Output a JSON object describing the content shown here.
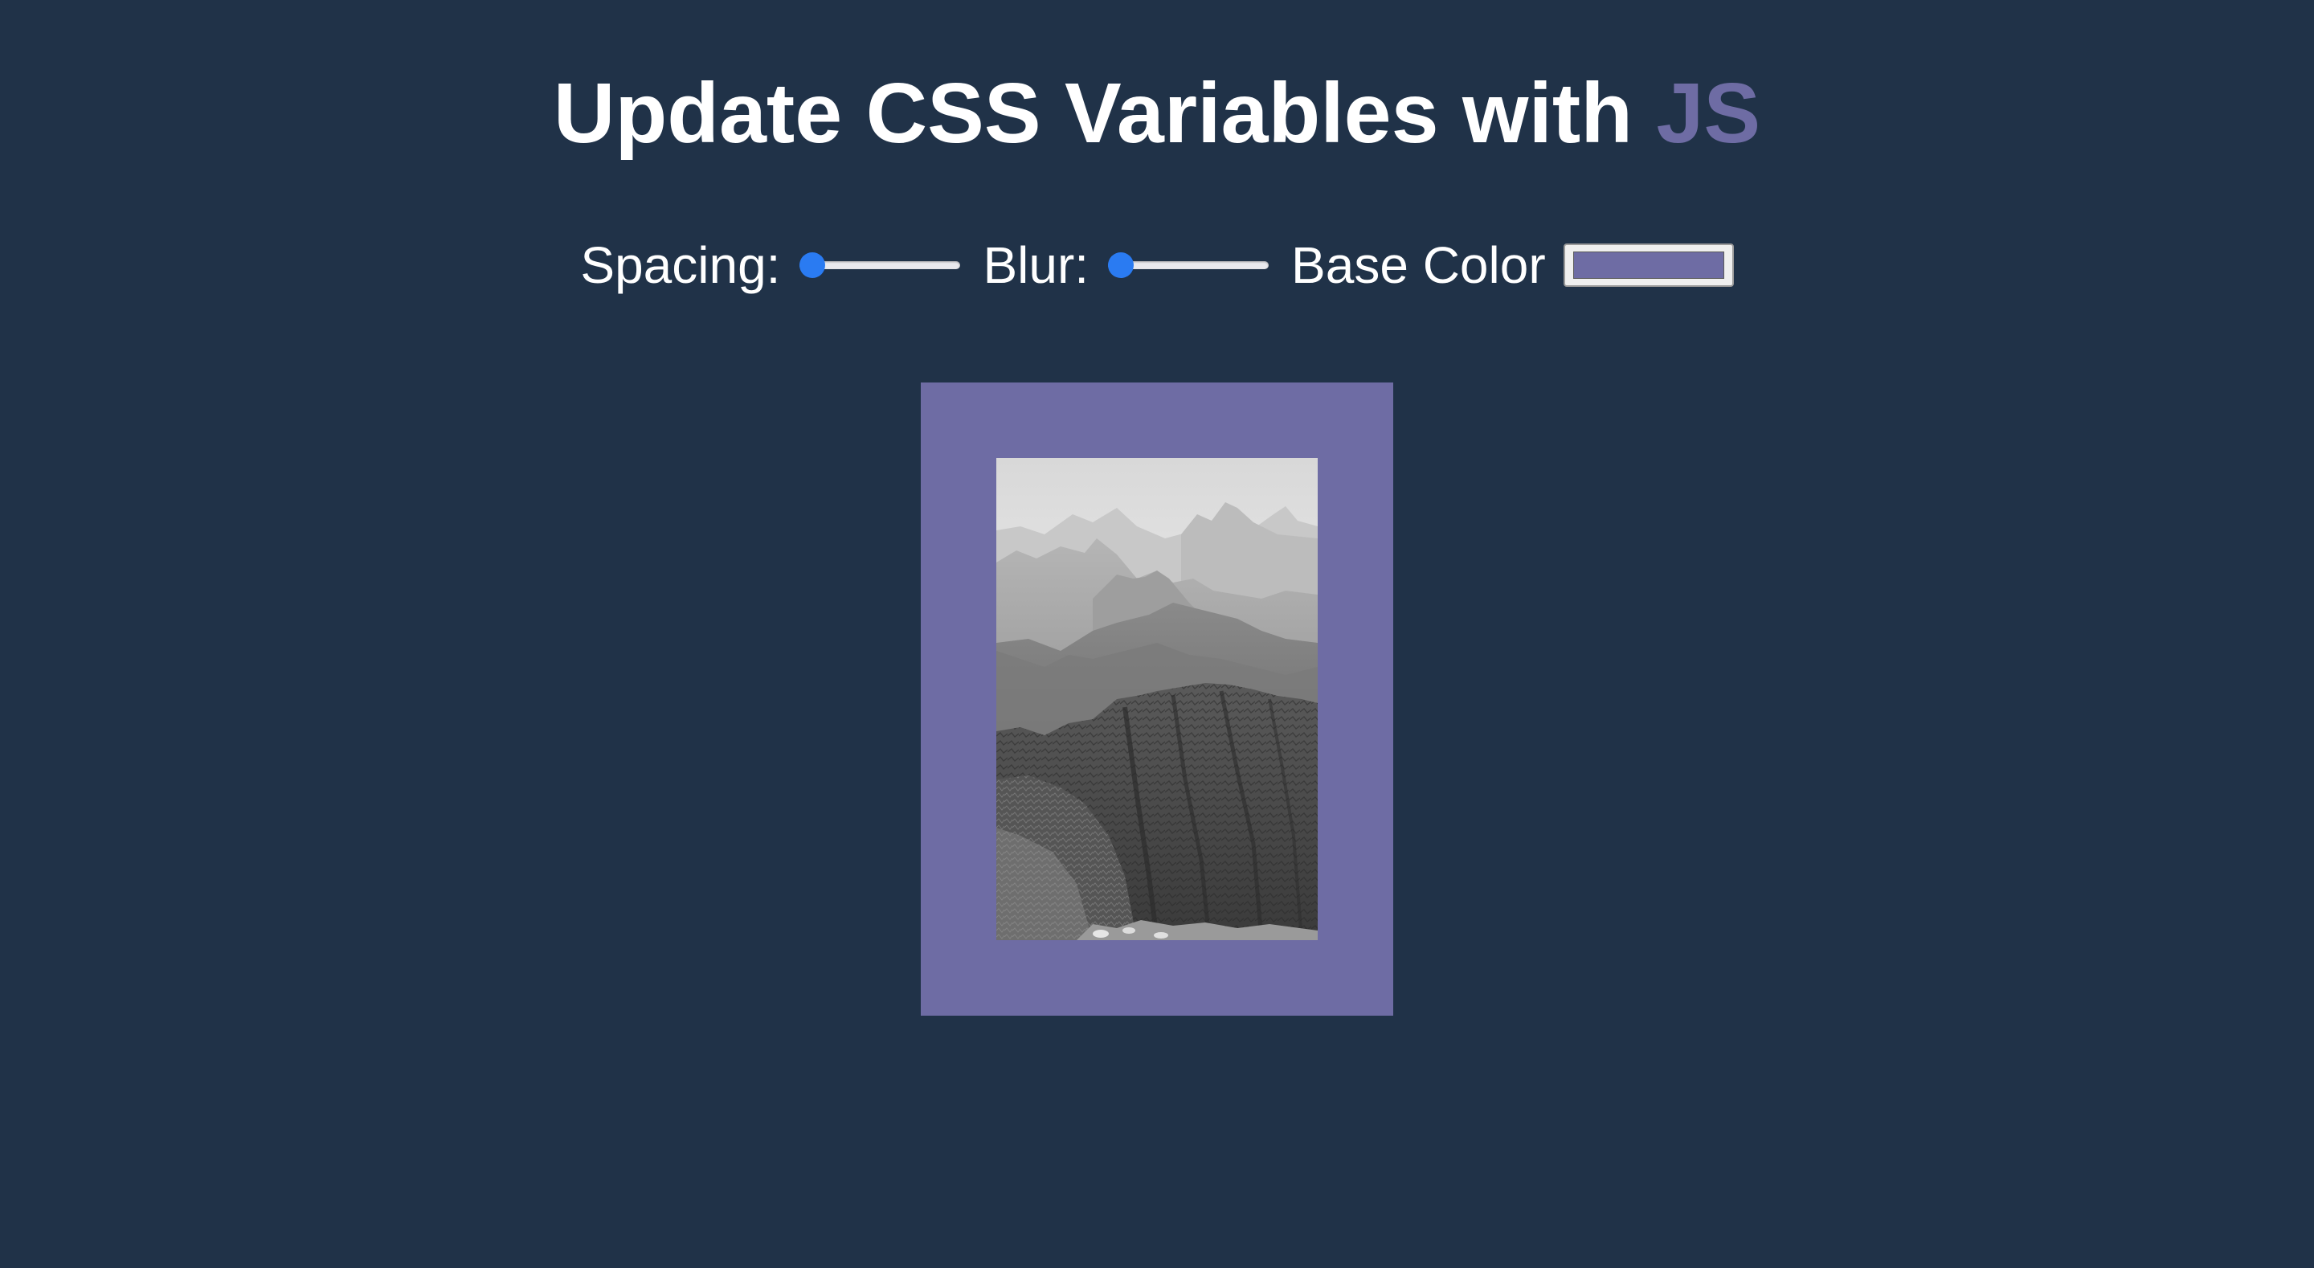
{
  "header": {
    "title_main": "Update CSS Variables with",
    "title_highlight": "JS"
  },
  "controls": {
    "spacing": {
      "label": "Spacing:",
      "value": 10,
      "min": 10,
      "max": 200
    },
    "blur": {
      "label": "Blur:",
      "value": 0,
      "min": 0,
      "max": 25
    },
    "base_color": {
      "label": "Base Color",
      "value": "#6e6ca4"
    }
  },
  "colors": {
    "background": "#203248",
    "accent": "#6e6ca4",
    "slider_active": "#2a7bf2",
    "text": "#ffffff"
  },
  "image": {
    "subject": "black-and-white mountain landscape"
  }
}
